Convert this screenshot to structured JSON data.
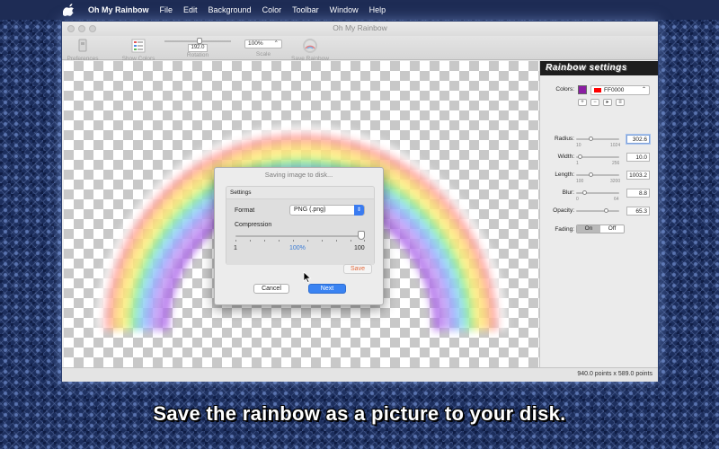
{
  "menubar": {
    "items": [
      "Oh My Rainbow",
      "File",
      "Edit",
      "Background",
      "Color",
      "Toolbar",
      "Window",
      "Help"
    ]
  },
  "window": {
    "title": "Oh My Rainbow",
    "toolbar": {
      "preferences": "Preferences",
      "show_colors": "Show Colors",
      "rotation_label": "Rotation",
      "rotation_value": "192.0",
      "scale_label": "Scale",
      "scale_value": "100%",
      "save_rainbow": "Save Rainbow"
    },
    "status": "940.0 points x 589.0 points"
  },
  "panel": {
    "title": "Rainbow settings",
    "colors_label": "Colors:",
    "color_value": "FF0000",
    "swatch_color": "#8b1da3",
    "radius": {
      "label": "Radius:",
      "value": "302.6",
      "min": "10",
      "max": "1024",
      "fraction": 0.29
    },
    "width": {
      "label": "Width:",
      "value": "10.0",
      "min": "1",
      "max": "256",
      "fraction": 0.04
    },
    "length": {
      "label": "Length:",
      "value": "1003.2",
      "min": "100",
      "max": "3200",
      "fraction": 0.29
    },
    "blur": {
      "label": "Blur:",
      "value": "8.8",
      "min": "0",
      "max": "64",
      "fraction": 0.14
    },
    "opacity": {
      "label": "Opacity:",
      "value": "65.3",
      "fraction": 0.65
    },
    "fading": {
      "label": "Fading:",
      "on": "On",
      "off": "Off",
      "selected": "On"
    }
  },
  "dialog": {
    "title": "Saving image to disk...",
    "group_label": "Settings",
    "format_label": "Format",
    "format_value": "PNG (.png)",
    "compression_label": "Compression",
    "compression_min": "1",
    "compression_mid": "100%",
    "compression_max": "100",
    "compression_fraction": 1.0,
    "save_button": "Save",
    "cancel_button": "Cancel",
    "next_button": "Next"
  },
  "caption": "Save the rainbow as a picture to your disk."
}
